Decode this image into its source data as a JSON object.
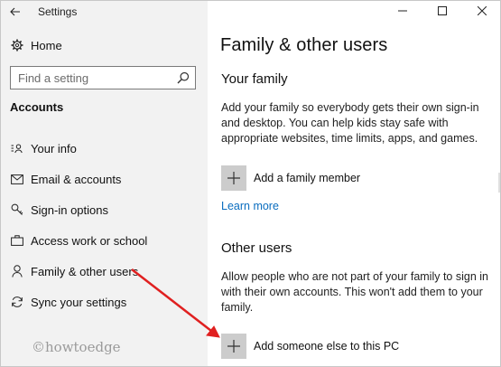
{
  "window": {
    "title": "Settings",
    "controls": {
      "minimize": "–",
      "maximize": "☐",
      "close": "✕"
    }
  },
  "sidebar": {
    "back_icon": "back-arrow-icon",
    "home_label": "Home",
    "search_placeholder": "Find a setting",
    "section_label": "Accounts",
    "items": [
      {
        "label": "Your info",
        "icon": "person-card-icon"
      },
      {
        "label": "Email & accounts",
        "icon": "mail-icon"
      },
      {
        "label": "Sign-in options",
        "icon": "key-icon"
      },
      {
        "label": "Access work or school",
        "icon": "briefcase-icon"
      },
      {
        "label": "Family & other users",
        "icon": "person-icon"
      },
      {
        "label": "Sync your settings",
        "icon": "sync-icon"
      }
    ]
  },
  "main": {
    "title": "Family & other users",
    "your_family": {
      "heading": "Your family",
      "description": "Add your family so everybody gets their own sign-in and desktop. You can help kids stay safe with appropriate websites, time limits, apps, and games.",
      "add_label": "Add a family member",
      "learn_more": "Learn more"
    },
    "other_users": {
      "heading": "Other users",
      "description": "Allow people who are not part of your family to sign in with their own accounts. This won't add them to your family.",
      "add_label": "Add someone else to this PC"
    }
  },
  "watermark": "©howtoedge",
  "colors": {
    "sidebar_bg": "#f2f2f2",
    "link": "#0a6dbf",
    "plus_tile": "#cccccc",
    "annotation_arrow": "#e02020"
  }
}
